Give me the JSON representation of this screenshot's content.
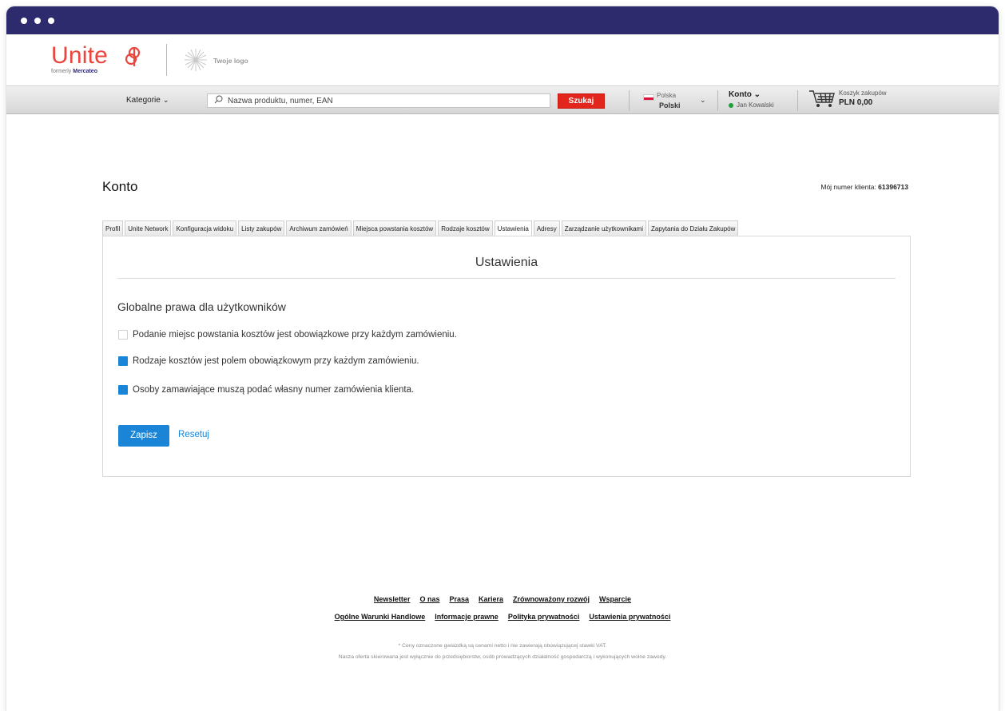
{
  "header": {
    "brand_name": "Unite",
    "brand_formerly": "formerly",
    "brand_formerly_name": "Mercateo",
    "your_logo": "Twoje logo"
  },
  "nav": {
    "categories_label": "Kategorie",
    "search_placeholder": "Nazwa produktu, numer, EAN",
    "search_button": "Szukaj",
    "country": "Polska",
    "language": "Polski",
    "account_label": "Konto",
    "account_user": "Jan Kowalski",
    "cart_label": "Koszyk zakupów",
    "cart_amount": "PLN 0,00"
  },
  "page": {
    "title": "Konto",
    "client_number_label": "Mój numer klienta: ",
    "client_number": "61396713"
  },
  "tabs": [
    {
      "label": "Profil",
      "active": false
    },
    {
      "label": "Unite Network",
      "active": false
    },
    {
      "label": "Konfiguracja widoku",
      "active": false
    },
    {
      "label": "Listy zakupów",
      "active": false
    },
    {
      "label": "Archiwum zamówień",
      "active": false
    },
    {
      "label": "Miejsca powstania kosztów",
      "active": false
    },
    {
      "label": "Rodzaje kosztów",
      "active": false
    },
    {
      "label": "Ustawienia",
      "active": true
    },
    {
      "label": "Adresy",
      "active": false
    },
    {
      "label": "Zarządzanie użytkownikami",
      "active": false
    },
    {
      "label": "Zapytania do Działu Zakupów",
      "active": false
    }
  ],
  "settings": {
    "panel_title": "Ustawienia",
    "section_title": "Globalne prawa dla użytkowników",
    "options": [
      {
        "label": "Podanie miejsc powstania kosztów jest obowiązkowe przy każdym zamówieniu.",
        "checked": false
      },
      {
        "label": "Rodzaje kosztów jest polem obowiązkowym przy każdym zamówieniu.",
        "checked": true
      },
      {
        "label": "Osoby zamawiające muszą podać własny numer zamówienia klienta.",
        "checked": true
      }
    ],
    "save_button": "Zapisz",
    "reset_link": "Resetuj"
  },
  "footer": {
    "links_row1": [
      "Newsletter",
      "O nas",
      "Prasa",
      "Kariera",
      "Zrównoważony rozwój",
      "Wsparcie"
    ],
    "links_row2": [
      "Ogólne Warunki Handlowe",
      "Informacje prawne",
      "Polityka prywatności",
      "Ustawienia prywatności"
    ],
    "note1": "* Ceny oznaczone gwiazdką są cenami netto i nie zawierają obowiązującej stawki VAT.",
    "note2": "Nasza oferta skierowana jest wyłącznie do przedsiębiorstw, osób prowadzących działalność gospodarczą i wykonujących wolne zawody."
  },
  "colors": {
    "titlebar": "#2d2a6e",
    "brand": "#e8463e",
    "search_button": "#e3261c",
    "accent": "#1a84d6"
  }
}
